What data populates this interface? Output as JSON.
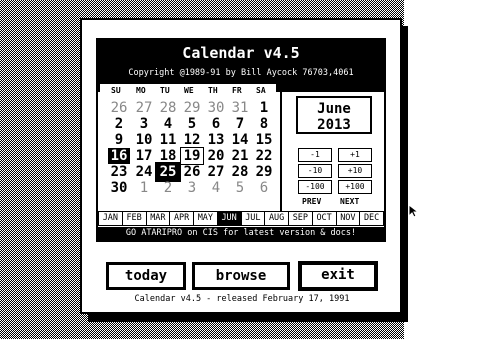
{
  "window": {
    "title": "Calendar v4.5",
    "copyright": "Copyright @1989-91 by Bill Aycock 76703,4061",
    "notice": "GO ATARIPRO on CIS for latest version & docs!",
    "footer": "Calendar v4.5 - released February 17, 1991"
  },
  "calendar": {
    "weekdays": [
      "SU",
      "MO",
      "TU",
      "WE",
      "TH",
      "FR",
      "SA"
    ],
    "weeks": [
      [
        {
          "d": "26",
          "dim": true
        },
        {
          "d": "27",
          "dim": true
        },
        {
          "d": "28",
          "dim": true
        },
        {
          "d": "29",
          "dim": true
        },
        {
          "d": "30",
          "dim": true
        },
        {
          "d": "31",
          "dim": true
        },
        {
          "d": "1"
        }
      ],
      [
        {
          "d": "2"
        },
        {
          "d": "3"
        },
        {
          "d": "4"
        },
        {
          "d": "5"
        },
        {
          "d": "6"
        },
        {
          "d": "7"
        },
        {
          "d": "8"
        }
      ],
      [
        {
          "d": "9"
        },
        {
          "d": "10"
        },
        {
          "d": "11"
        },
        {
          "d": "12"
        },
        {
          "d": "13"
        },
        {
          "d": "14"
        },
        {
          "d": "15"
        }
      ],
      [
        {
          "d": "16",
          "today": true
        },
        {
          "d": "17"
        },
        {
          "d": "18"
        },
        {
          "d": "19",
          "sel": true
        },
        {
          "d": "20"
        },
        {
          "d": "21"
        },
        {
          "d": "22"
        }
      ],
      [
        {
          "d": "23"
        },
        {
          "d": "24"
        },
        {
          "d": "25",
          "inv": true
        },
        {
          "d": "26"
        },
        {
          "d": "27"
        },
        {
          "d": "28"
        },
        {
          "d": "29"
        }
      ],
      [
        {
          "d": "30"
        },
        {
          "d": "1",
          "dim": true
        },
        {
          "d": "2",
          "dim": true
        },
        {
          "d": "3",
          "dim": true
        },
        {
          "d": "4",
          "dim": true
        },
        {
          "d": "5",
          "dim": true
        },
        {
          "d": "6",
          "dim": true
        }
      ]
    ],
    "month": "June",
    "year": "2013"
  },
  "adjust": {
    "prev": [
      "-1",
      "-10",
      "-100"
    ],
    "next": [
      "+1",
      "+10",
      "+100"
    ],
    "prev_label": "PREV",
    "next_label": "NEXT"
  },
  "months": [
    "JAN",
    "FEB",
    "MAR",
    "APR",
    "MAY",
    "JUN",
    "JUL",
    "AUG",
    "SEP",
    "OCT",
    "NOV",
    "DEC"
  ],
  "current_month_index": 5,
  "buttons": {
    "today": "today",
    "browse": "browse",
    "exit": "exit"
  }
}
